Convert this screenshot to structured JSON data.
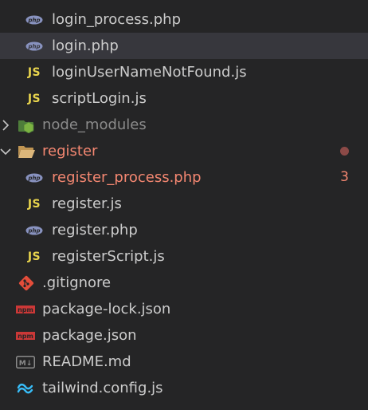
{
  "explorer": {
    "items": [
      {
        "label": "login_process.php",
        "icon": "php-icon",
        "indent": 1
      },
      {
        "label": "login.php",
        "icon": "php-icon",
        "indent": 1,
        "selected": true
      },
      {
        "label": "loginUserNameNotFound.js",
        "icon": "js-icon",
        "indent": 1
      },
      {
        "label": "scriptLogin.js",
        "icon": "js-icon",
        "indent": 1
      },
      {
        "label": "node_modules",
        "icon": "node-folder-icon",
        "indent": 0,
        "type": "folder",
        "expanded": false
      },
      {
        "label": "register",
        "icon": "folder-open-icon",
        "indent": 0,
        "type": "folder",
        "expanded": true,
        "status": "modified-dot"
      },
      {
        "label": "register_process.php",
        "icon": "php-icon",
        "indent": 1,
        "problems": "3"
      },
      {
        "label": "register.js",
        "icon": "js-icon",
        "indent": 1
      },
      {
        "label": "register.php",
        "icon": "php-icon",
        "indent": 1
      },
      {
        "label": "registerScript.js",
        "icon": "js-icon",
        "indent": 1
      },
      {
        "label": ".gitignore",
        "icon": "git-icon",
        "indent": 0
      },
      {
        "label": "package-lock.json",
        "icon": "npm-icon",
        "indent": 0
      },
      {
        "label": "package.json",
        "icon": "npm-icon",
        "indent": 0
      },
      {
        "label": "README.md",
        "icon": "markdown-icon",
        "indent": 0
      },
      {
        "label": "tailwind.config.js",
        "icon": "tailwind-icon",
        "indent": 0
      }
    ],
    "js_text": "JS",
    "php_text": "php",
    "npm_text": "npm",
    "md_text": "M↓"
  },
  "colors": {
    "background": "#252526",
    "selected": "#37373d",
    "text": "#cccccc",
    "error": "#f48771",
    "js": "#e8d44d",
    "php": "#8892bf",
    "npm": "#cb3837",
    "git": "#e44d3a",
    "tailwind": "#38bdf8",
    "node": "#6aa84f"
  }
}
